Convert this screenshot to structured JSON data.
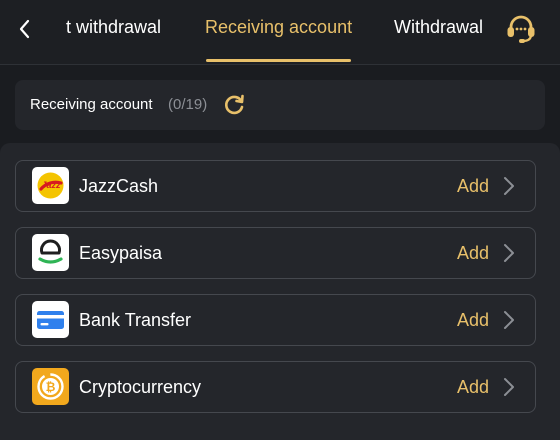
{
  "header": {
    "tabs": [
      {
        "label": "t withdrawal"
      },
      {
        "label": "Receiving account"
      },
      {
        "label": "Withdrawal"
      }
    ],
    "active_tab": "Receiving account"
  },
  "summary": {
    "label": "Receiving account",
    "count": "(0/19)"
  },
  "accounts": [
    {
      "name": "JazzCash",
      "action": "Add",
      "icon": "jazzcash-logo-icon"
    },
    {
      "name": "Easypaisa",
      "action": "Add",
      "icon": "easypaisa-logo-icon"
    },
    {
      "name": "Bank Transfer",
      "action": "Add",
      "icon": "bank-card-icon"
    },
    {
      "name": "Cryptocurrency",
      "action": "Add",
      "icon": "bitcoin-icon"
    }
  ],
  "colors": {
    "accent": "#e8c06a",
    "background": "#1a1c20",
    "panel": "#24262b",
    "border": "#45484e",
    "muted_text": "#8c8f95"
  }
}
